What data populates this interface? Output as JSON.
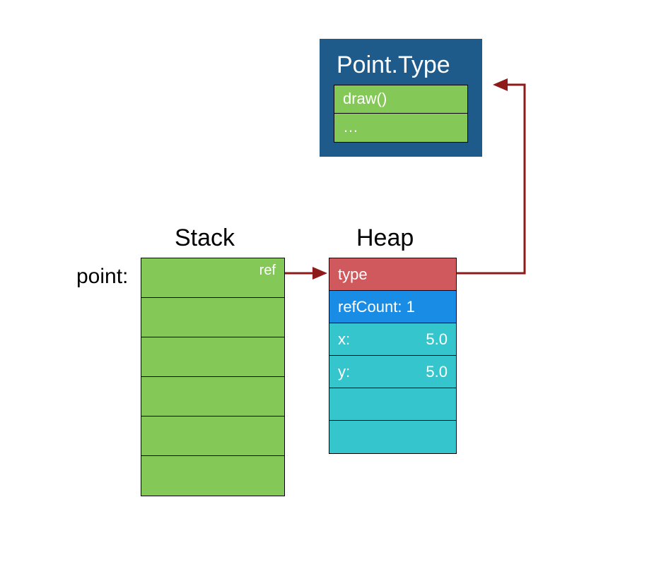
{
  "typeBox": {
    "title": "Point.Type",
    "rows": [
      "draw()",
      "…"
    ]
  },
  "columns": {
    "stack": "Stack",
    "heap": "Heap"
  },
  "pointLabel": "point:",
  "stack": {
    "row0": "ref"
  },
  "heap": {
    "type": "type",
    "refCountLabel": "refCount: 1",
    "xLabel": "x:",
    "xValue": "5.0",
    "yLabel": "y:",
    "yValue": "5.0"
  },
  "colors": {
    "typeBoxBg": "#1f5b8a",
    "green": "#84c957",
    "red": "#cf595c",
    "blue": "#198de5",
    "cyan": "#34c6cc",
    "arrow": "#8f1a1a"
  }
}
